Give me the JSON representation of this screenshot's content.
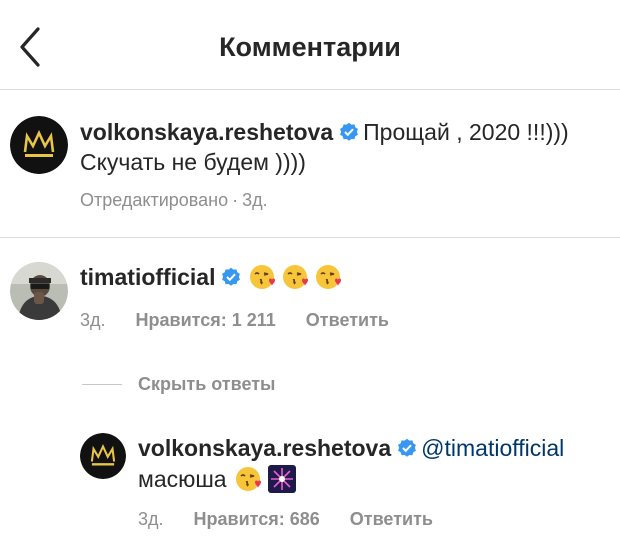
{
  "header": {
    "title": "Комментарии"
  },
  "caption": {
    "username": "volkonskaya.reshetova",
    "text_line1": "Прощай , 2020 !!!)))",
    "text_line2": "Скучать не будем ))))",
    "edited_label": "Отредактировано",
    "separator": "·",
    "time": "3д."
  },
  "comment": {
    "username": "timatiofficial",
    "emojis": [
      "face-blowing-kiss-icon",
      "face-blowing-kiss-icon",
      "face-blowing-kiss-icon"
    ],
    "time": "3д.",
    "likes_label": "Нравится: 1 211",
    "reply_label": "Ответить"
  },
  "replies_toggle": {
    "label": "Скрыть ответы"
  },
  "reply": {
    "username": "volkonskaya.reshetova",
    "mention": "@timatiofficial",
    "text": "масюша",
    "emojis": [
      "face-blowing-kiss-icon",
      "firework-sparkle-icon"
    ],
    "time": "3д.",
    "likes_label": "Нравится: 686",
    "reply_label": "Ответить"
  },
  "colors": {
    "text": "#262626",
    "secondary": "#8e8e8e",
    "verified": "#3897f0",
    "mention": "#00376b",
    "divider": "#dbdbdb"
  }
}
